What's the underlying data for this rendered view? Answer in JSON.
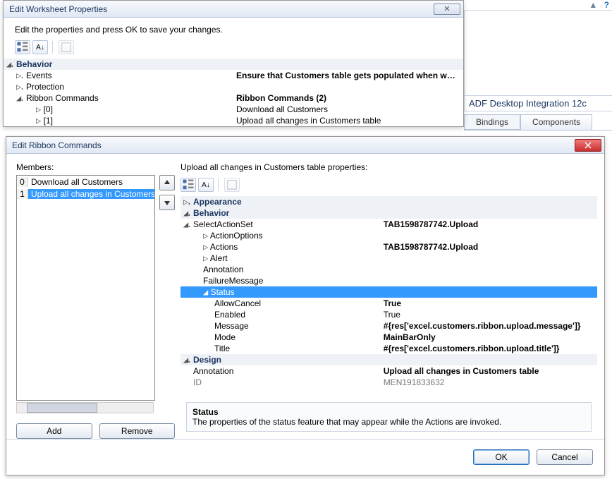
{
  "background": {
    "panel_header": "ADF Desktop Integration 12c",
    "tab_bindings": "Bindings",
    "tab_components": "Components"
  },
  "win1": {
    "title": "Edit Worksheet Properties",
    "subtitle": "Edit the properties and press OK to save your changes.",
    "rows": {
      "cat_behavior": "Behavior",
      "events": "Events",
      "events_val": "Ensure that Customers table gets populated when workbo",
      "protection": "Protection",
      "ribbon": "Ribbon Commands",
      "ribbon_val": "Ribbon Commands (2)",
      "r0": "[0]",
      "r0_val": "Download all Customers",
      "r1": "[1]",
      "r1_val": "Upload all changes in Customers table"
    }
  },
  "win2": {
    "title": "Edit Ribbon Commands",
    "members_label": "Members:",
    "members": [
      {
        "i": "0",
        "label": "Download all Customers"
      },
      {
        "i": "1",
        "label": "Upload all changes in Customers"
      }
    ],
    "selected_index": 1,
    "prop_header": "Upload all changes in Customers table properties:",
    "props": {
      "cat_appearance": "Appearance",
      "cat_behavior": "Behavior",
      "select_action_set": "SelectActionSet",
      "select_action_set_val": "TAB1598787742.Upload",
      "action_options": "ActionOptions",
      "actions": "Actions",
      "actions_val": "TAB1598787742.Upload",
      "alert": "Alert",
      "annotation": "Annotation",
      "failure_message": "FailureMessage",
      "status": "Status",
      "allow_cancel": "AllowCancel",
      "allow_cancel_val": "True",
      "enabled": "Enabled",
      "enabled_val": "True",
      "message": "Message",
      "message_val": "#{res['excel.customers.ribbon.upload.message']}",
      "mode": "Mode",
      "mode_val": "MainBarOnly",
      "title": "Title",
      "title_val": "#{res['excel.customers.ribbon.upload.title']}",
      "cat_design": "Design",
      "design_annotation": "Annotation",
      "design_annotation_val": "Upload all changes in Customers table",
      "id": "ID",
      "id_val": "MEN191833632"
    },
    "help_title": "Status",
    "help_text": "The properties of the status feature that may appear while the Actions are invoked.",
    "btn_add": "Add",
    "btn_remove": "Remove",
    "btn_ok": "OK",
    "btn_cancel": "Cancel"
  }
}
